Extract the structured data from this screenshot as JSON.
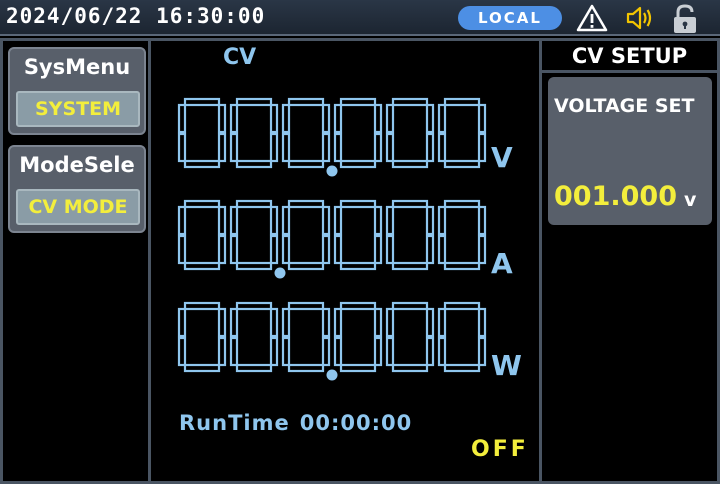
{
  "status_bar": {
    "datetime": "2024/06/22 16:30:00",
    "remote_mode": "LOCAL",
    "icons": [
      "warning-icon",
      "speaker-icon",
      "lock-icon"
    ],
    "accent_color": "#4d8fe4"
  },
  "left_menu": [
    {
      "title": "SysMenu",
      "button": "SYSTEM"
    },
    {
      "title": "ModeSele",
      "button": "CV MODE"
    }
  ],
  "display": {
    "mode": "CV",
    "readings": [
      {
        "value": "000.000",
        "unit": "V"
      },
      {
        "value": "00.0000",
        "unit": "A"
      },
      {
        "value": "000.000",
        "unit": "W"
      }
    ],
    "runtime_label": "RunTime",
    "runtime_value": "00:00:00",
    "output_state": "OFF",
    "segment_color": "#8fc6ee",
    "highlight_color": "#f3ee3c"
  },
  "setup_panel": {
    "title": "CV SETUP",
    "setting_label": "VOLTAGE SET",
    "setting_value": "001.000",
    "setting_unit": "v"
  }
}
